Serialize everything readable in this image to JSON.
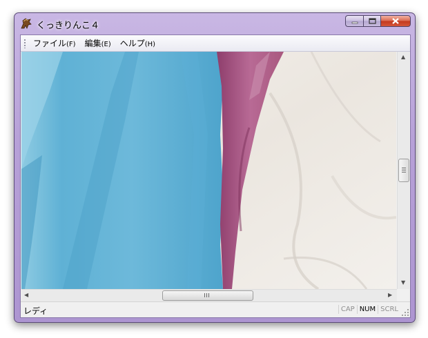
{
  "window": {
    "title": "くっきりんこ４",
    "caption_buttons": [
      "minimize",
      "maximize",
      "close"
    ]
  },
  "menu": {
    "items": [
      {
        "label": "ファイル",
        "accel": "(F)"
      },
      {
        "label": "編集",
        "accel": "(E)"
      },
      {
        "label": "ヘルプ",
        "accel": "(H)"
      }
    ]
  },
  "image": {
    "description_colors": {
      "left": "#6fb6d6",
      "middle": "#b0648f",
      "right": "#f0ebe4"
    }
  },
  "scrollbars": {
    "vertical_position": 0.5,
    "horizontal_position": 0.47
  },
  "status": {
    "text": "レディ",
    "indicators": [
      {
        "label": "CAP",
        "active": false
      },
      {
        "label": "NUM",
        "active": true
      },
      {
        "label": "SCRL",
        "active": false
      }
    ]
  },
  "icons": [
    "app-horse-icon",
    "minimize-icon",
    "maximize-icon",
    "close-icon",
    "scroll-up-arrow-icon",
    "scroll-down-arrow-icon",
    "scroll-left-arrow-icon",
    "scroll-right-arrow-icon",
    "size-grip-icon"
  ]
}
